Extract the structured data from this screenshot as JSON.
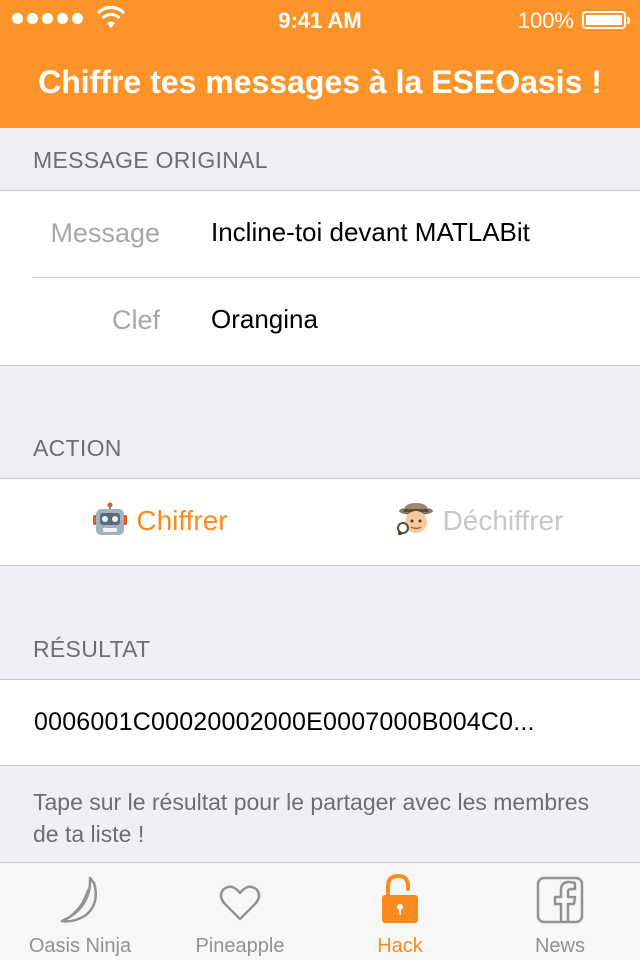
{
  "status_bar": {
    "time": "9:41 AM",
    "battery": "100%"
  },
  "nav": {
    "title": "Chiffre tes messages à la ESEOasis !"
  },
  "original": {
    "header": "MESSAGE ORIGINAL",
    "message_label": "Message",
    "message_value": "Incline-toi devant MATLABit",
    "key_label": "Clef",
    "key_value": "Orangina"
  },
  "action": {
    "header": "ACTION",
    "cipher_label": "Chiffrer",
    "decipher_label": "Déchiffrer",
    "cipher_icon": "robot-icon",
    "decipher_icon": "detective-icon"
  },
  "result": {
    "header": "RÉSULTAT",
    "value": "0006001C00020002000E0007000B004C0...",
    "note": "Tape sur le résultat pour le partager avec les membres de ta liste !"
  },
  "tabs": [
    {
      "label": "Oasis Ninja",
      "icon": "banana-icon"
    },
    {
      "label": "Pineapple",
      "icon": "heart-icon"
    },
    {
      "label": "Hack",
      "icon": "unlock-icon",
      "active": true
    },
    {
      "label": "News",
      "icon": "facebook-icon"
    }
  ],
  "colors": {
    "accent": "#fd942a",
    "active_tint": "#fd8a1c",
    "inactive_tint": "#929292",
    "background": "#efeff4"
  }
}
